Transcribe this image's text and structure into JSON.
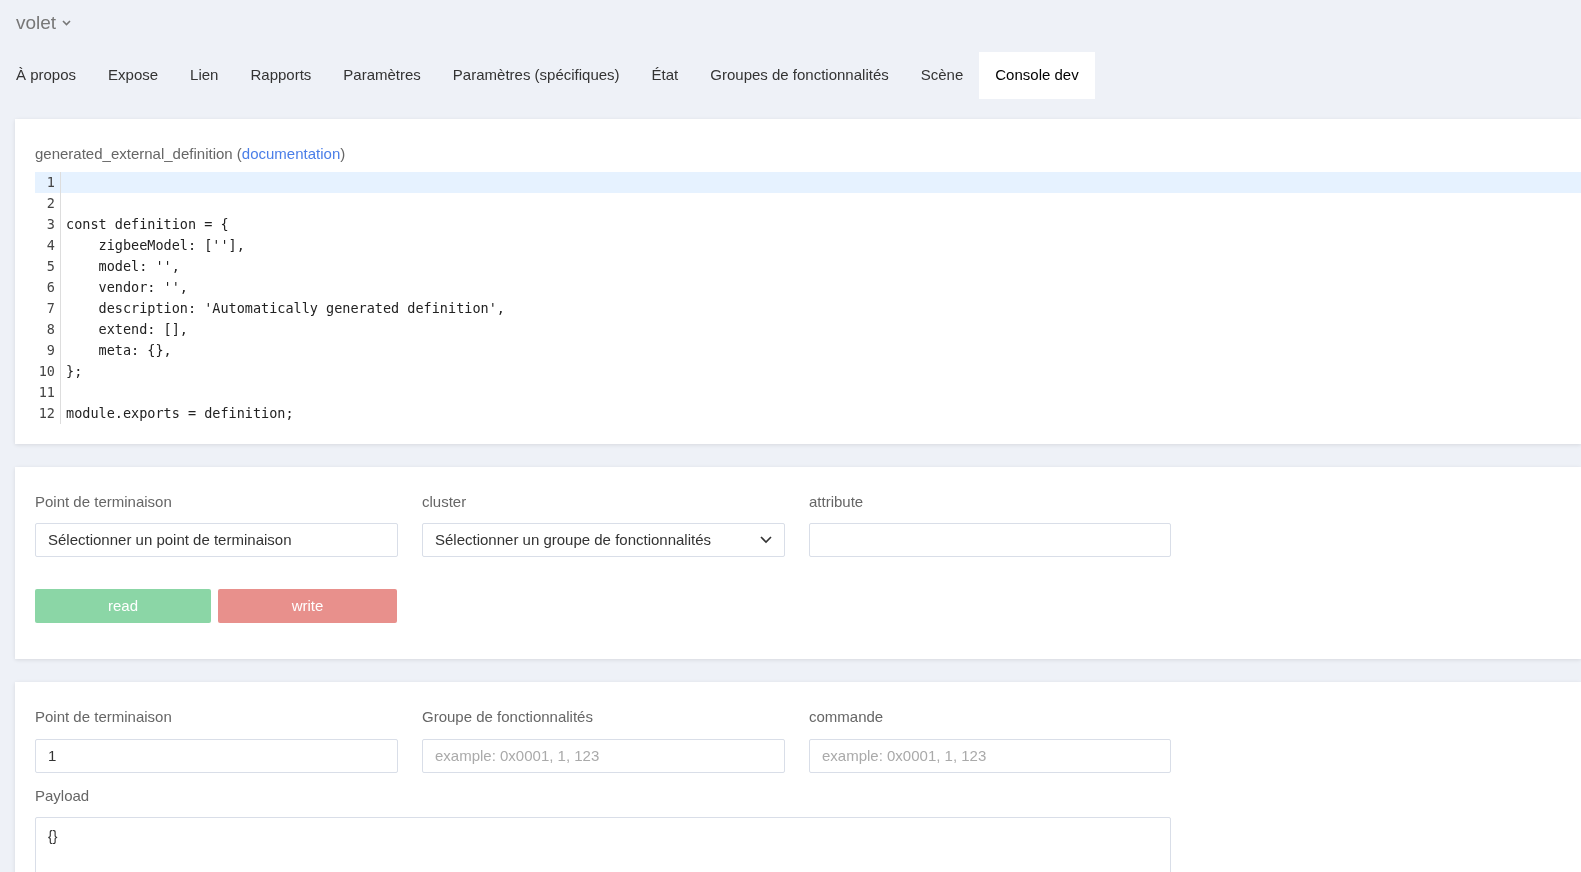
{
  "header": {
    "title": "volet"
  },
  "tabs": [
    {
      "label": "À propos",
      "selected": false
    },
    {
      "label": "Expose",
      "selected": false
    },
    {
      "label": "Lien",
      "selected": false
    },
    {
      "label": "Rapports",
      "selected": false
    },
    {
      "label": "Paramètres",
      "selected": false
    },
    {
      "label": "Paramètres (spécifiques)",
      "selected": false
    },
    {
      "label": "État",
      "selected": false
    },
    {
      "label": "Groupes de fonctionnalités",
      "selected": false
    },
    {
      "label": "Scène",
      "selected": false
    },
    {
      "label": "Console dev",
      "selected": true
    }
  ],
  "definition": {
    "label": "generated_external_definition (",
    "link": "documentation",
    "label_end": ")",
    "lines": [
      {
        "number": "1",
        "highlighted": true
      },
      {
        "number": "2",
        "highlighted": false
      },
      {
        "number": "3",
        "text": "const definition = {",
        "highlighted": false
      },
      {
        "number": "4",
        "text": "    zigbeeModel: [''],",
        "highlighted": false
      },
      {
        "number": "5",
        "text": "    model: '',",
        "highlighted": false
      },
      {
        "number": "6",
        "text": "    vendor: '',",
        "highlighted": false
      },
      {
        "number": "7",
        "text": "    description: 'Automatically generated definition',",
        "highlighted": false
      },
      {
        "number": "8",
        "text": "    extend: [],",
        "highlighted": false
      },
      {
        "number": "9",
        "text": "    meta: {},",
        "highlighted": false
      },
      {
        "number": "10",
        "text": "};",
        "highlighted": false
      },
      {
        "number": "11",
        "highlighted": false
      },
      {
        "number": "12",
        "text": "module.exports = definition;",
        "highlighted": false
      }
    ]
  },
  "attribute_panel": {
    "fields": [
      {
        "kind": "select",
        "label": "Point de terminaison",
        "value": "Sélectionner un point de terminaison"
      },
      {
        "kind": "dropdown",
        "label": "cluster",
        "value": "Sélectionner un groupe de fonctionnalités"
      },
      {
        "kind": "input",
        "label": "attribute"
      }
    ],
    "buttons": [
      {
        "label": "read",
        "kind": "read",
        "disabled": true
      },
      {
        "label": "write",
        "kind": "write",
        "disabled": true
      }
    ]
  },
  "command_panel": {
    "fields": [
      {
        "kind": "input",
        "label": "Point de terminaison",
        "value": "1"
      },
      {
        "kind": "input",
        "label": "Groupe de fonctionnalités",
        "placeholder": "example: 0x0001, 1, 123"
      },
      {
        "kind": "input",
        "label": "commande",
        "placeholder": "example: 0x0001, 1, 123"
      }
    ],
    "payload": {
      "label": "Payload",
      "value": "{}"
    }
  }
}
